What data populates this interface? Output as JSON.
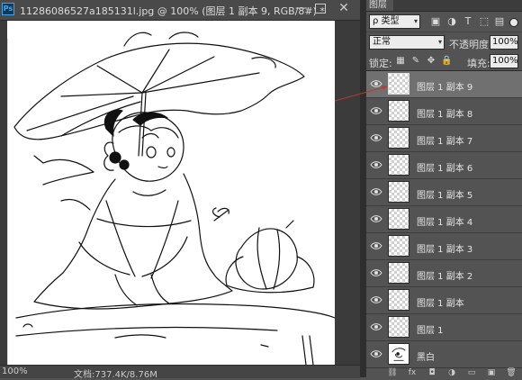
{
  "document": {
    "ps_badge": "Ps",
    "title": "11286086527a185131l.jpg @ 100% (图层 1 副本 9, RGB/8#) *",
    "window_controls": {
      "minimize": "—",
      "close": "✕"
    },
    "zoom": "100%",
    "doc_size": "文档:737.4K/8.76M"
  },
  "panel": {
    "tab_label": "图层",
    "filter": {
      "label": "ρ 类型",
      "arrow": "▾",
      "icons": [
        "image-filter-icon",
        "adjustment-filter-icon",
        "type-filter-icon",
        "shape-filter-icon",
        "smart-object-filter-icon"
      ]
    },
    "filter_icon_glyphs": [
      "▣",
      "◑",
      "T",
      "⬚",
      "▤"
    ],
    "blend": {
      "mode": "正常",
      "arrow": "▾"
    },
    "opacity": {
      "label": "不透明度:",
      "value": "100%"
    },
    "lock": {
      "label": "锁定:",
      "glyphs": [
        "▦",
        "✎",
        "✥",
        "🔒"
      ]
    },
    "fill": {
      "label": "填充:",
      "value": "100%"
    },
    "layers": [
      {
        "name": "图层 1 副本 9",
        "selected": true
      },
      {
        "name": "图层 1 副本 8",
        "selected": false
      },
      {
        "name": "图层 1 副本 7",
        "selected": false
      },
      {
        "name": "图层 1 副本 6",
        "selected": false
      },
      {
        "name": "图层 1 副本 5",
        "selected": false
      },
      {
        "name": "图层 1 副本 4",
        "selected": false
      },
      {
        "name": "图层 1 副本 3",
        "selected": false
      },
      {
        "name": "图层 1 副本 2",
        "selected": false
      },
      {
        "name": "图层 1 副本",
        "selected": false
      },
      {
        "name": "图层 1",
        "selected": false
      },
      {
        "name": "黑白",
        "selected": false
      }
    ],
    "bottom_glyphs": [
      "⛓",
      "fx",
      "◘",
      "◑",
      "▭",
      "▣",
      "🗑"
    ]
  }
}
